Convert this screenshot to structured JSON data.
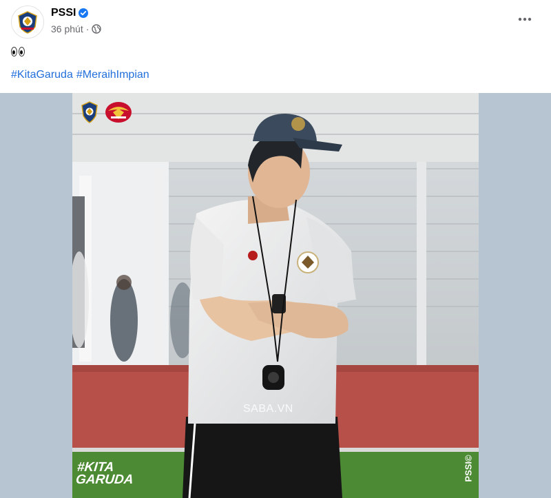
{
  "post": {
    "author": "PSSI",
    "time": "36 phút",
    "emoji": "👀",
    "hashtags": [
      "#KitaGaruda",
      "#MeraihImpian"
    ]
  },
  "image": {
    "watermark": "SABA.VN",
    "brand_line1": "#KITA",
    "brand_line2": "GARUDA",
    "side_label": "PSSI©"
  },
  "icons": {
    "verified": "verified-badge-icon",
    "audience": "globe-icon",
    "more": "more-options-icon"
  },
  "colors": {
    "link": "#216fdb",
    "verified": "#1877f2",
    "backdrop": "#b7c5d3",
    "track": "#b8504a",
    "grass": "#4c8a34"
  }
}
